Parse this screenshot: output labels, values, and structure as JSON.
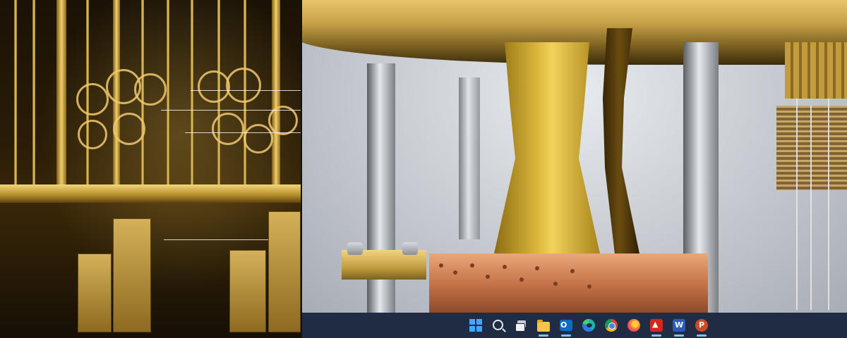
{
  "wallpaper": {
    "left_panel": "gold-cryostat-chandelier",
    "right_panel": "lab-cryostat-ribbon-cable"
  },
  "taskbar": {
    "background_color": "#1f2c44",
    "items": [
      {
        "id": "start",
        "icon": "windows-start-icon",
        "active": false
      },
      {
        "id": "search",
        "icon": "search-icon",
        "active": false
      },
      {
        "id": "task-view",
        "icon": "task-view-icon",
        "active": false
      },
      {
        "id": "file-explorer",
        "icon": "file-explorer-icon",
        "active": true
      },
      {
        "id": "outlook",
        "icon": "outlook-icon",
        "active": true
      },
      {
        "id": "edge",
        "icon": "edge-icon",
        "active": false
      },
      {
        "id": "chrome",
        "icon": "chrome-icon",
        "active": false
      },
      {
        "id": "firefox",
        "icon": "firefox-icon",
        "active": false
      },
      {
        "id": "acrobat",
        "icon": "acrobat-icon",
        "active": true
      },
      {
        "id": "word",
        "icon": "word-icon",
        "active": true
      },
      {
        "id": "powerpoint",
        "icon": "powerpoint-icon",
        "active": true
      }
    ]
  }
}
